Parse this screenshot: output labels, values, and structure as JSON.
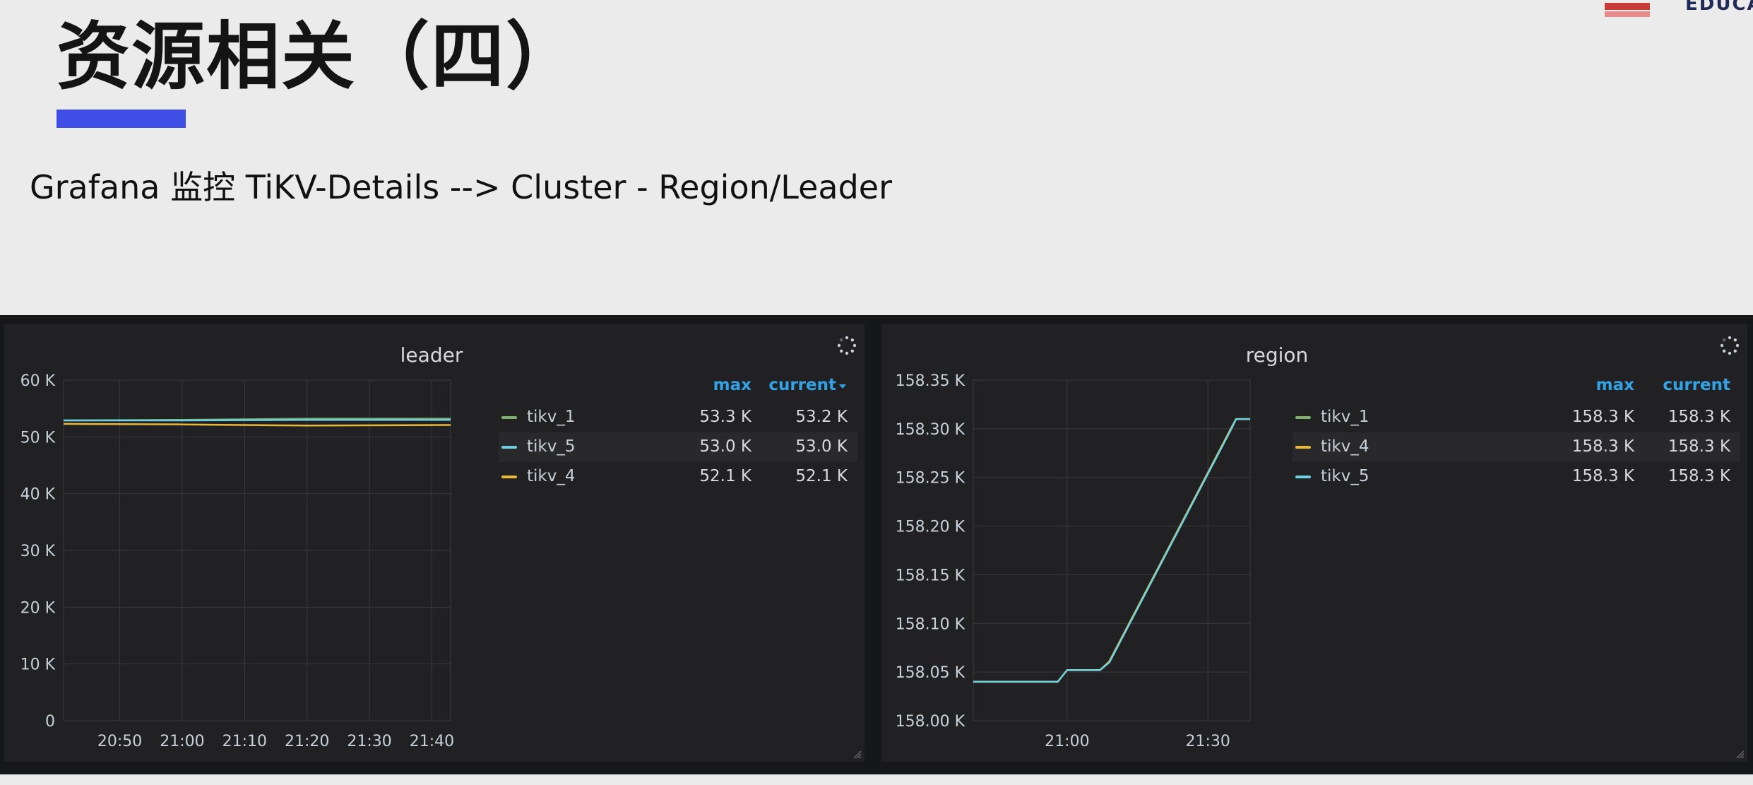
{
  "slide": {
    "title": "资源相关（四）",
    "subtitle": "Grafana 监控 TiKV-Details --> Cluster - Region/Leader",
    "brand_text": "EDUCATION",
    "accent_color": "#3f4fe6"
  },
  "chart_data": [
    {
      "type": "line",
      "title": "leader",
      "xlabel": "",
      "ylabel": "",
      "x_ticks": [
        "20:50",
        "21:00",
        "21:10",
        "21:20",
        "21:30",
        "21:40"
      ],
      "y_ticks": [
        "60 K",
        "50 K",
        "40 K",
        "30 K",
        "20 K",
        "10 K",
        "0"
      ],
      "x_range": [
        "20:41",
        "21:43"
      ],
      "ylim": [
        0,
        60000
      ],
      "grid": true,
      "legend_placement": "right",
      "legend_columns": [
        "max",
        "current"
      ],
      "sort_indicator": "caret-down-icon",
      "series": [
        {
          "name": "tikv_1",
          "color": "#7eb26d",
          "max": "53.3 K",
          "current": "53.2 K",
          "x": [
            "20:41",
            "21:00",
            "21:20",
            "21:43"
          ],
          "values": [
            52900,
            53000,
            53200,
            53200
          ]
        },
        {
          "name": "tikv_5",
          "color": "#6ed0e0",
          "max": "53.0 K",
          "current": "53.0 K",
          "x": [
            "20:41",
            "21:00",
            "21:20",
            "21:43"
          ],
          "values": [
            52900,
            52900,
            53000,
            53000
          ]
        },
        {
          "name": "tikv_4",
          "color": "#eab839",
          "max": "52.1 K",
          "current": "52.1 K",
          "x": [
            "20:41",
            "21:00",
            "21:20",
            "21:43"
          ],
          "values": [
            52300,
            52200,
            52000,
            52100
          ]
        }
      ]
    },
    {
      "type": "line",
      "title": "region",
      "xlabel": "",
      "ylabel": "",
      "x_ticks": [
        "21:00",
        "21:30"
      ],
      "y_ticks": [
        "158.35 K",
        "158.30 K",
        "158.25 K",
        "158.20 K",
        "158.15 K",
        "158.10 K",
        "158.05 K",
        "158.00 K"
      ],
      "x_range": [
        "20:40",
        "21:39"
      ],
      "ylim": [
        158000,
        158350
      ],
      "grid": true,
      "legend_placement": "right",
      "legend_columns": [
        "max",
        "current"
      ],
      "series": [
        {
          "name": "tikv_1",
          "color": "#7eb26d",
          "max": "158.3 K",
          "current": "158.3 K",
          "x": [
            "20:40",
            "20:58",
            "21:00",
            "21:07",
            "21:09",
            "21:35",
            "21:36",
            "21:39"
          ],
          "values": [
            158040,
            158040,
            158052,
            158052,
            158060,
            158300,
            158310,
            158310
          ]
        },
        {
          "name": "tikv_4",
          "color": "#eab839",
          "max": "158.3 K",
          "current": "158.3 K",
          "x": [
            "20:40",
            "20:58",
            "21:00",
            "21:07",
            "21:09",
            "21:35",
            "21:36",
            "21:39"
          ],
          "values": [
            158040,
            158040,
            158052,
            158052,
            158061,
            158301,
            158310,
            158310
          ]
        },
        {
          "name": "tikv_5",
          "color": "#6ed0e0",
          "max": "158.3 K",
          "current": "158.3 K",
          "x": [
            "20:40",
            "20:58",
            "21:00",
            "21:07",
            "21:09",
            "21:35",
            "21:36",
            "21:39"
          ],
          "values": [
            158040,
            158040,
            158052,
            158052,
            158060,
            158300,
            158310,
            158310
          ]
        }
      ]
    }
  ]
}
